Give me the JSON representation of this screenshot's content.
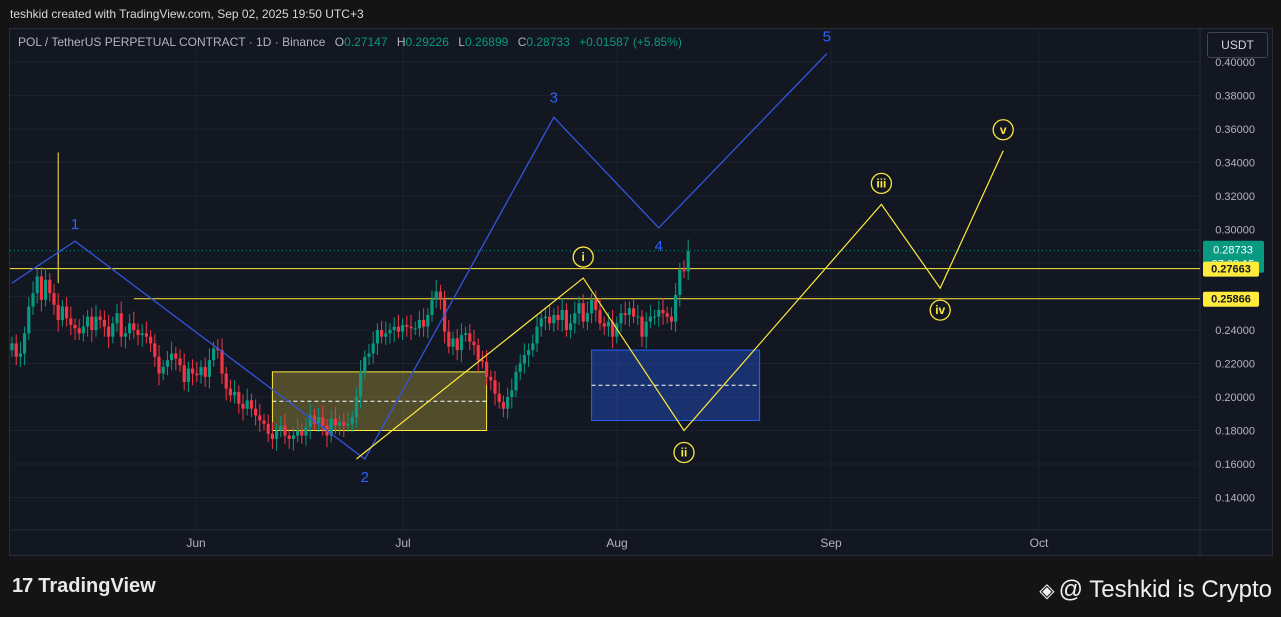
{
  "header": {
    "author_line": "teshkid created with TradingView.com, Sep 02, 2025 19:50 UTC+3"
  },
  "legend": {
    "symbol": "POL / TetherUS PERPETUAL CONTRACT · 1D · Binance",
    "open_label": "O",
    "open": "0.27147",
    "high_label": "H",
    "high": "0.29226",
    "low_label": "L",
    "low": "0.26899",
    "close_label": "C",
    "close": "0.28733",
    "change": "+0.01587 (+5.85%)"
  },
  "currency_button": "USDT",
  "footer": {
    "logo_mark": "17",
    "logo_text": "TradingView",
    "watermark": "@ Teshkid is Crypto"
  },
  "colors": {
    "up": "#089981",
    "down": "#f23645",
    "wave_blue": "#3355dd",
    "wave_yellow": "#ffeb3b",
    "background": "#131722"
  },
  "chart_data": {
    "type": "candlestick",
    "timeframe": "1D",
    "ylim": [
      0.125,
      0.408
    ],
    "y_ticks": [
      "0.40000",
      "0.38000",
      "0.36000",
      "0.34000",
      "0.32000",
      "0.30000",
      "0.28000",
      "0.26000",
      "0.24000",
      "0.22000",
      "0.20000",
      "0.18000",
      "0.16000",
      "0.14000"
    ],
    "x_ticks": [
      "Jun",
      "Jul",
      "Aug",
      "Sep",
      "Oct"
    ],
    "price_labels": {
      "current": "0.28733",
      "countdown": "07:09:15",
      "level_1": "0.27663",
      "level_2": "0.25866"
    },
    "horizontal_levels": [
      0.27663,
      0.25866
    ],
    "close_series": [
      0.232,
      0.224,
      0.226,
      0.238,
      0.254,
      0.262,
      0.272,
      0.258,
      0.27,
      0.262,
      0.255,
      0.246,
      0.254,
      0.247,
      0.243,
      0.241,
      0.238,
      0.242,
      0.248,
      0.24,
      0.248,
      0.246,
      0.242,
      0.236,
      0.244,
      0.25,
      0.236,
      0.238,
      0.244,
      0.24,
      0.237,
      0.238,
      0.236,
      0.232,
      0.224,
      0.214,
      0.218,
      0.222,
      0.226,
      0.223,
      0.219,
      0.209,
      0.217,
      0.214,
      0.213,
      0.218,
      0.212,
      0.222,
      0.229,
      0.228,
      0.214,
      0.205,
      0.201,
      0.203,
      0.196,
      0.193,
      0.198,
      0.193,
      0.189,
      0.186,
      0.184,
      0.178,
      0.175,
      0.18,
      0.183,
      0.177,
      0.175,
      0.177,
      0.18,
      0.177,
      0.182,
      0.189,
      0.184,
      0.188,
      0.183,
      0.177,
      0.187,
      0.183,
      0.185,
      0.183,
      0.184,
      0.188,
      0.2,
      0.215,
      0.224,
      0.226,
      0.232,
      0.24,
      0.236,
      0.238,
      0.24,
      0.242,
      0.239,
      0.243,
      0.242,
      0.241,
      0.241,
      0.246,
      0.242,
      0.249,
      0.258,
      0.263,
      0.258,
      0.239,
      0.23,
      0.235,
      0.228,
      0.237,
      0.238,
      0.233,
      0.231,
      0.222,
      0.221,
      0.212,
      0.21,
      0.202,
      0.197,
      0.193,
      0.2,
      0.204,
      0.215,
      0.22,
      0.225,
      0.228,
      0.232,
      0.242,
      0.247,
      0.248,
      0.244,
      0.249,
      0.246,
      0.252,
      0.24,
      0.244,
      0.25,
      0.256,
      0.245,
      0.25,
      0.258,
      0.252,
      0.244,
      0.242,
      0.245,
      0.236,
      0.244,
      0.25,
      0.249,
      0.253,
      0.248,
      0.248,
      0.236,
      0.245,
      0.248,
      0.248,
      0.252,
      0.25,
      0.248,
      0.245,
      0.261,
      0.276,
      0.275,
      0.287
    ],
    "wave_labels_blue": [
      "1",
      "2",
      "3",
      "4",
      "5"
    ],
    "wave_labels_yellow": [
      "i",
      "ii",
      "iii",
      "iv",
      "v"
    ],
    "blue_wave_path": [
      [
        0,
        0.268
      ],
      [
        15,
        0.293
      ],
      [
        84,
        0.163
      ],
      [
        129,
        0.367
      ],
      [
        154,
        0.301
      ],
      [
        194,
        0.405
      ]
    ],
    "yellow_wave_path": [
      [
        82,
        0.163
      ],
      [
        136,
        0.271
      ],
      [
        160,
        0.18
      ],
      [
        207,
        0.315
      ],
      [
        221,
        0.265
      ],
      [
        236,
        0.347
      ]
    ],
    "zones": [
      {
        "x0": 62,
        "x1": 113,
        "y0": 0.18,
        "y1": 0.215,
        "color": "yellow"
      },
      {
        "x0": 138,
        "x1": 178,
        "y0": 0.186,
        "y1": 0.228,
        "color": "blue"
      }
    ]
  }
}
